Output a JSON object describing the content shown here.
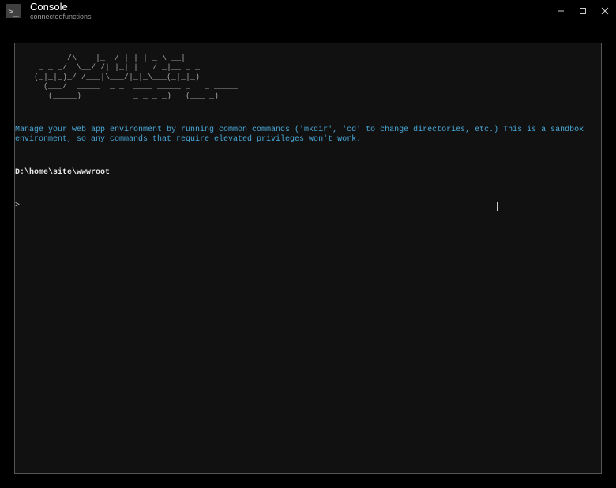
{
  "window": {
    "icon_glyph": ">_",
    "title": "Console",
    "subtitle": "connectedfunctions"
  },
  "terminal": {
    "ascii_art": "           /\\    |_  / | | | _ \\ __|\n     _ _ _/  \\__/ /| |_| |   / _|__ _ _\n    (_|_|_)_/ /___|\\___/|_|_\\___(_|_|_)\n      (___/  _____  _ _  ____ _____ _   _ _____\n       (_____)           _ _ _ _)   (___ _)",
    "info_text": "Manage your web app environment by running common commands ('mkdir', 'cd' to change directories, etc.) This is a sandbox environment, so any commands that require elevated privileges won't work.",
    "current_path": "D:\\home\\site\\wwwroot",
    "prompt": ">",
    "input_value": ""
  }
}
